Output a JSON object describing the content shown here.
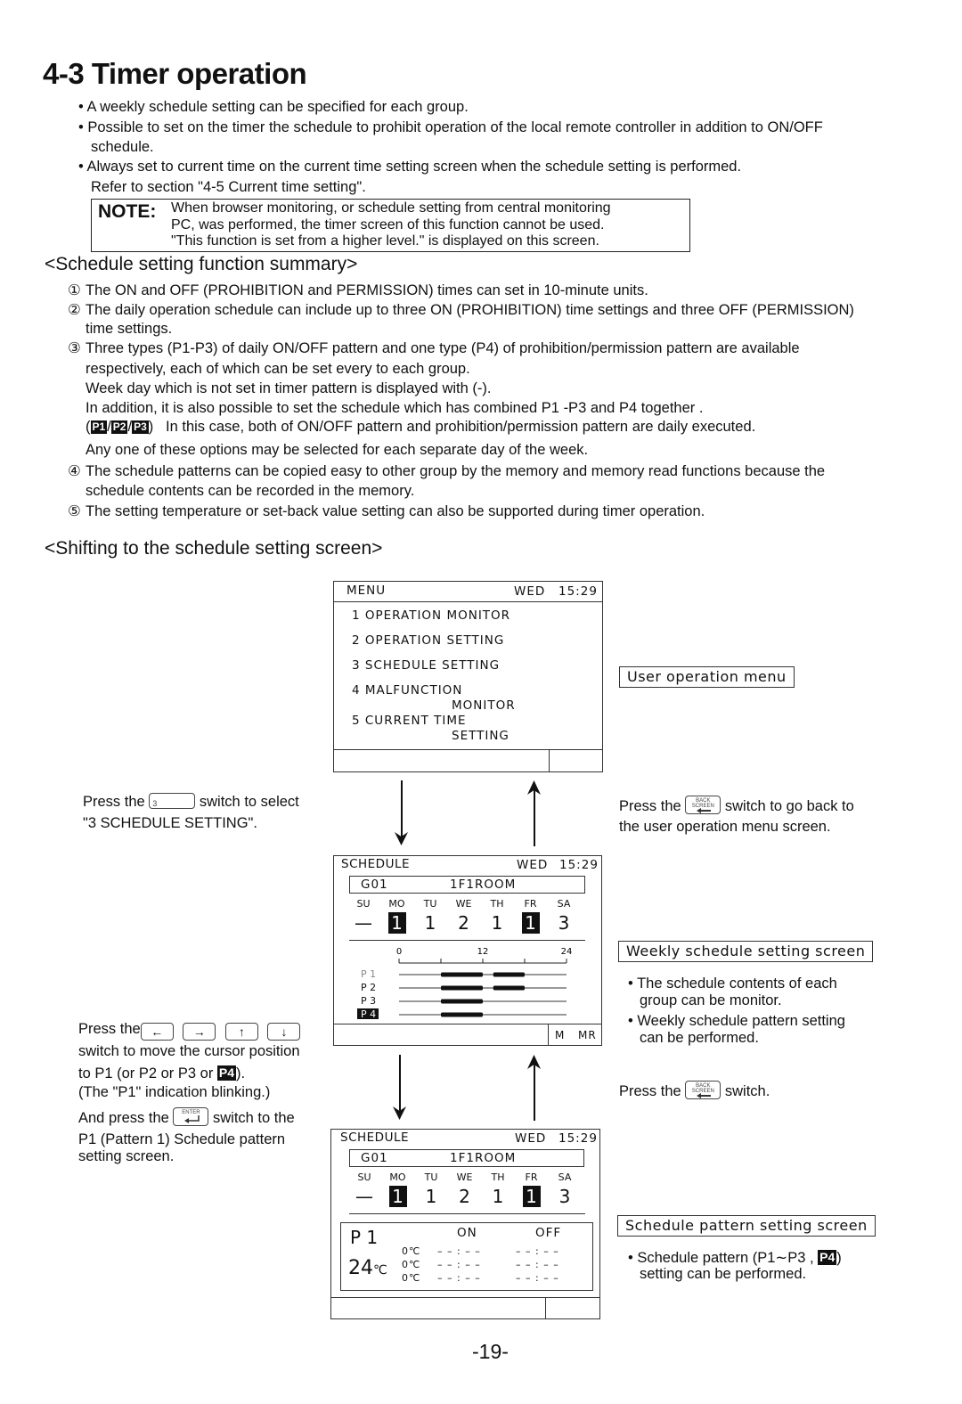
{
  "page": {
    "title": "4-3 Timer operation",
    "page_number": "-19-"
  },
  "intro": {
    "bullets": [
      "A weekly schedule setting can be  specified for each group.",
      "Possible to set on the timer the schedule to prohibit operation of the local remote controller in addition to ON/OFF",
      "schedule.",
      "Always set to current time on the current time setting screen when the schedule setting is performed.",
      "Refer to section \"4-5 Current time setting\"."
    ],
    "note": {
      "label": "NOTE:",
      "lines": [
        "When browser monitoring, or schedule setting from central monitoring",
        "PC, was performed, the timer screen of this function cannot be used.",
        "\"This function is set from a higher level.\" is displayed on this screen."
      ]
    }
  },
  "summary": {
    "heading": "<Schedule setting function summary>",
    "markers": [
      "①",
      "②",
      "③",
      "④",
      "⑤"
    ],
    "lines": [
      "The ON and OFF (PROHIBITION and PERMISSION) times can set in 10-minute units.",
      "The daily operation schedule can include up to three ON (PROHIBITION) time settings and three OFF (PERMISSION)",
      "time settings.",
      "Three types (P1-P3) of daily ON/OFF pattern and one type (P4) of prohibition/permission pattern are available",
      "respectively, each of which can be set every to each group.",
      "Week day which is not set in timer pattern is displayed with (-).",
      "In addition, it is also possible to set the schedule which has combined P1 -P3 and P4 together .",
      "In this case, both of ON/OFF pattern and prohibition/permission pattern are daily executed.",
      "Any one of these options may be selected for each separate day of the week.",
      "The schedule patterns can be copied easy to other group by the memory and memory read functions because the",
      "schedule contents can be recorded in the memory.",
      "The setting temperature or set-back value setting can also be supported during timer operation."
    ],
    "combo_labels": [
      "P1",
      "P2",
      "P3"
    ],
    "combo_open": "(",
    "combo_sep": "/",
    "combo_close": ")"
  },
  "shifting": {
    "heading": "<Shifting to the schedule setting screen>"
  },
  "menu_screen": {
    "title": "MENU",
    "day": "WED",
    "time": "15:29",
    "items": [
      "1 OPERATION MONITOR",
      "2 OPERATION SETTING",
      "3 SCHEDULE SETTING",
      "4 MALFUNCTION",
      "MONITOR",
      "5 CURRENT TIME",
      "SETTING"
    ],
    "caption": "User operation menu"
  },
  "instr1": {
    "pre": "Press the",
    "key": "3",
    "post": "switch to select",
    "line2": "\"3 SCHEDULE SETTING\"."
  },
  "back1": {
    "pre": "Press the",
    "key_top": "BACK",
    "key_bottom": "SCREEN",
    "post": "switch to go back to",
    "line2": "the user operation menu screen."
  },
  "weekly_screen": {
    "title": "SCHEDULE",
    "day": "WED",
    "time": "15:29",
    "group": "G01",
    "room": "1F1ROOM",
    "days": [
      "SU",
      "MO",
      "TU",
      "WE",
      "TH",
      "FR",
      "SA"
    ],
    "values": [
      "—",
      "1",
      "1",
      "2",
      "1",
      "1",
      "3"
    ],
    "highlighted": [
      false,
      true,
      false,
      false,
      false,
      true,
      false
    ],
    "axis_labels": [
      "0",
      "12",
      "24"
    ],
    "axis_ticks_hours": [
      0,
      6,
      12,
      18,
      24
    ],
    "patterns": [
      {
        "label": "P 1",
        "style": "blink",
        "blocks": [
          [
            6,
            12
          ],
          [
            13.5,
            18
          ]
        ]
      },
      {
        "label": "P 2",
        "style": "normal",
        "blocks": [
          [
            6,
            12
          ],
          [
            13.5,
            18
          ]
        ]
      },
      {
        "label": "P 3",
        "style": "normal",
        "blocks": [
          [
            6,
            12
          ]
        ]
      },
      {
        "label": "P 4",
        "style": "inverse",
        "blocks": [
          [
            6,
            12
          ]
        ]
      }
    ],
    "footer": [
      "M",
      "MR"
    ],
    "caption": "Weekly schedule setting screen",
    "bullets": [
      "The schedule contents of each",
      "group can be monitor.",
      "Weekly schedule pattern setting",
      "can be performed."
    ]
  },
  "instr2": {
    "pre": "Press the",
    "arrow_keys": [
      "←",
      "→",
      "↑",
      "↓"
    ],
    "line2": "switch to move the cursor position",
    "line3_pre": "to P1 (or P2 or P3 or",
    "line3_box": "P4",
    "line3_post": ").",
    "line4": "(The \"P1\" indication blinking.)",
    "line5_pre": "And press the",
    "enter_key": "ENTER",
    "line5_post": "switch to the",
    "line6": "P1 (Pattern  1) Schedule pattern",
    "line7": "setting screen."
  },
  "back2": {
    "pre": "Press the",
    "key_top": "BACK",
    "key_bottom": "SCREEN",
    "post": "switch."
  },
  "pattern_screen": {
    "title": "SCHEDULE",
    "day": "WED",
    "time": "15:29",
    "group": "G01",
    "room": "1F1ROOM",
    "days": [
      "SU",
      "MO",
      "TU",
      "WE",
      "TH",
      "FR",
      "SA"
    ],
    "values": [
      "—",
      "1",
      "1",
      "2",
      "1",
      "1",
      "3"
    ],
    "highlighted": [
      false,
      true,
      false,
      false,
      false,
      true,
      false
    ],
    "pattern_label": "P 1",
    "temperature": "24",
    "temp_unit": "℃",
    "on_label": "ON",
    "off_label": "OFF",
    "rows": [
      {
        "temp": "0℃",
        "on": "– – : – –",
        "off": "– – : – –"
      },
      {
        "temp": "0℃",
        "on": "– – : – –",
        "off": "– – : – –"
      },
      {
        "temp": "0℃",
        "on": "– – : – –",
        "off": "– – : – –"
      }
    ],
    "caption": "Schedule pattern setting screen",
    "bullet_pre": "Schedule pattern (P1∼P3 ,",
    "bullet_box": "P4",
    "bullet_post": ")",
    "bullet_line2": "setting can be performed."
  }
}
